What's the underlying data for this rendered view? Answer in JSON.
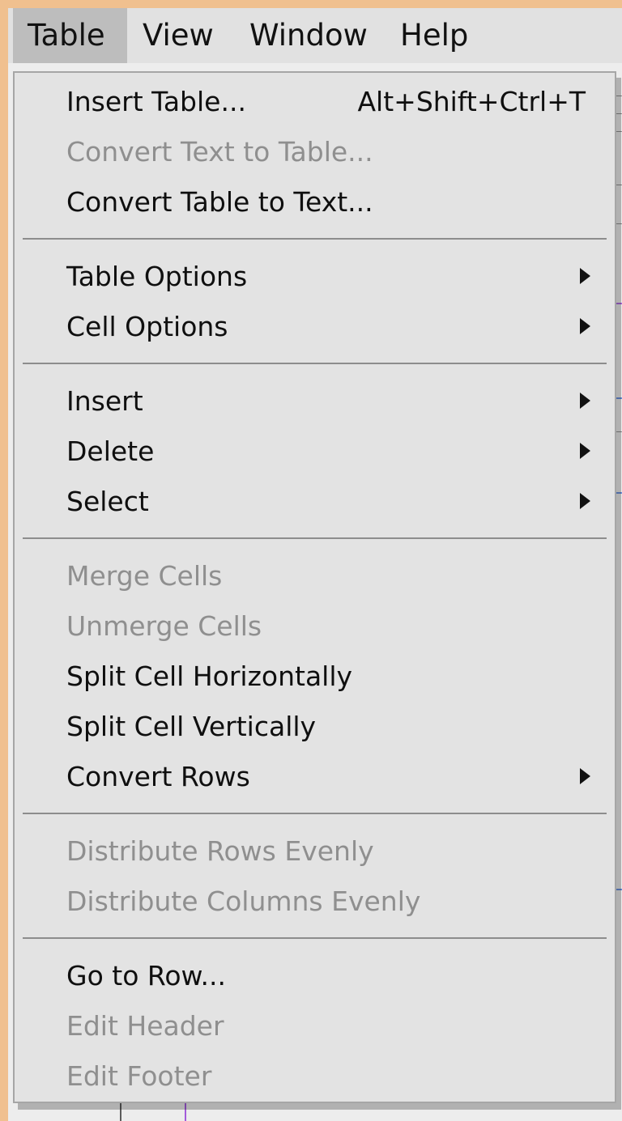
{
  "menubar": {
    "items": [
      {
        "label": "Table",
        "active": true
      },
      {
        "label": "View",
        "active": false
      },
      {
        "label": "Window",
        "active": false
      },
      {
        "label": "Help",
        "active": false
      }
    ]
  },
  "table_menu": {
    "groups": [
      [
        {
          "label": "Insert Table...",
          "shortcut": "Alt+Shift+Ctrl+T",
          "enabled": true,
          "has_submenu": false
        },
        {
          "label": "Convert Text to Table...",
          "shortcut": "",
          "enabled": false,
          "has_submenu": false
        },
        {
          "label": "Convert Table to Text...",
          "shortcut": "",
          "enabled": true,
          "has_submenu": false
        }
      ],
      [
        {
          "label": "Table Options",
          "shortcut": "",
          "enabled": true,
          "has_submenu": true
        },
        {
          "label": "Cell Options",
          "shortcut": "",
          "enabled": true,
          "has_submenu": true
        }
      ],
      [
        {
          "label": "Insert",
          "shortcut": "",
          "enabled": true,
          "has_submenu": true
        },
        {
          "label": "Delete",
          "shortcut": "",
          "enabled": true,
          "has_submenu": true
        },
        {
          "label": "Select",
          "shortcut": "",
          "enabled": true,
          "has_submenu": true
        }
      ],
      [
        {
          "label": "Merge Cells",
          "shortcut": "",
          "enabled": false,
          "has_submenu": false
        },
        {
          "label": "Unmerge Cells",
          "shortcut": "",
          "enabled": false,
          "has_submenu": false
        },
        {
          "label": "Split Cell Horizontally",
          "shortcut": "",
          "enabled": true,
          "has_submenu": false
        },
        {
          "label": "Split Cell Vertically",
          "shortcut": "",
          "enabled": true,
          "has_submenu": false
        },
        {
          "label": "Convert Rows",
          "shortcut": "",
          "enabled": true,
          "has_submenu": true
        }
      ],
      [
        {
          "label": "Distribute Rows Evenly",
          "shortcut": "",
          "enabled": false,
          "has_submenu": false
        },
        {
          "label": "Distribute Columns Evenly",
          "shortcut": "",
          "enabled": false,
          "has_submenu": false
        }
      ],
      [
        {
          "label": "Go to Row...",
          "shortcut": "",
          "enabled": true,
          "has_submenu": false
        },
        {
          "label": "Edit Header",
          "shortcut": "",
          "enabled": false,
          "has_submenu": false
        },
        {
          "label": "Edit Footer",
          "shortcut": "",
          "enabled": false,
          "has_submenu": false
        }
      ]
    ]
  },
  "theme": {
    "frame_color": "#f0c08f",
    "menu_bg": "#e3e3e3",
    "text_enabled": "#0f0f0f",
    "text_disabled": "#8f8f8f",
    "separator": "#8d8d8d"
  }
}
